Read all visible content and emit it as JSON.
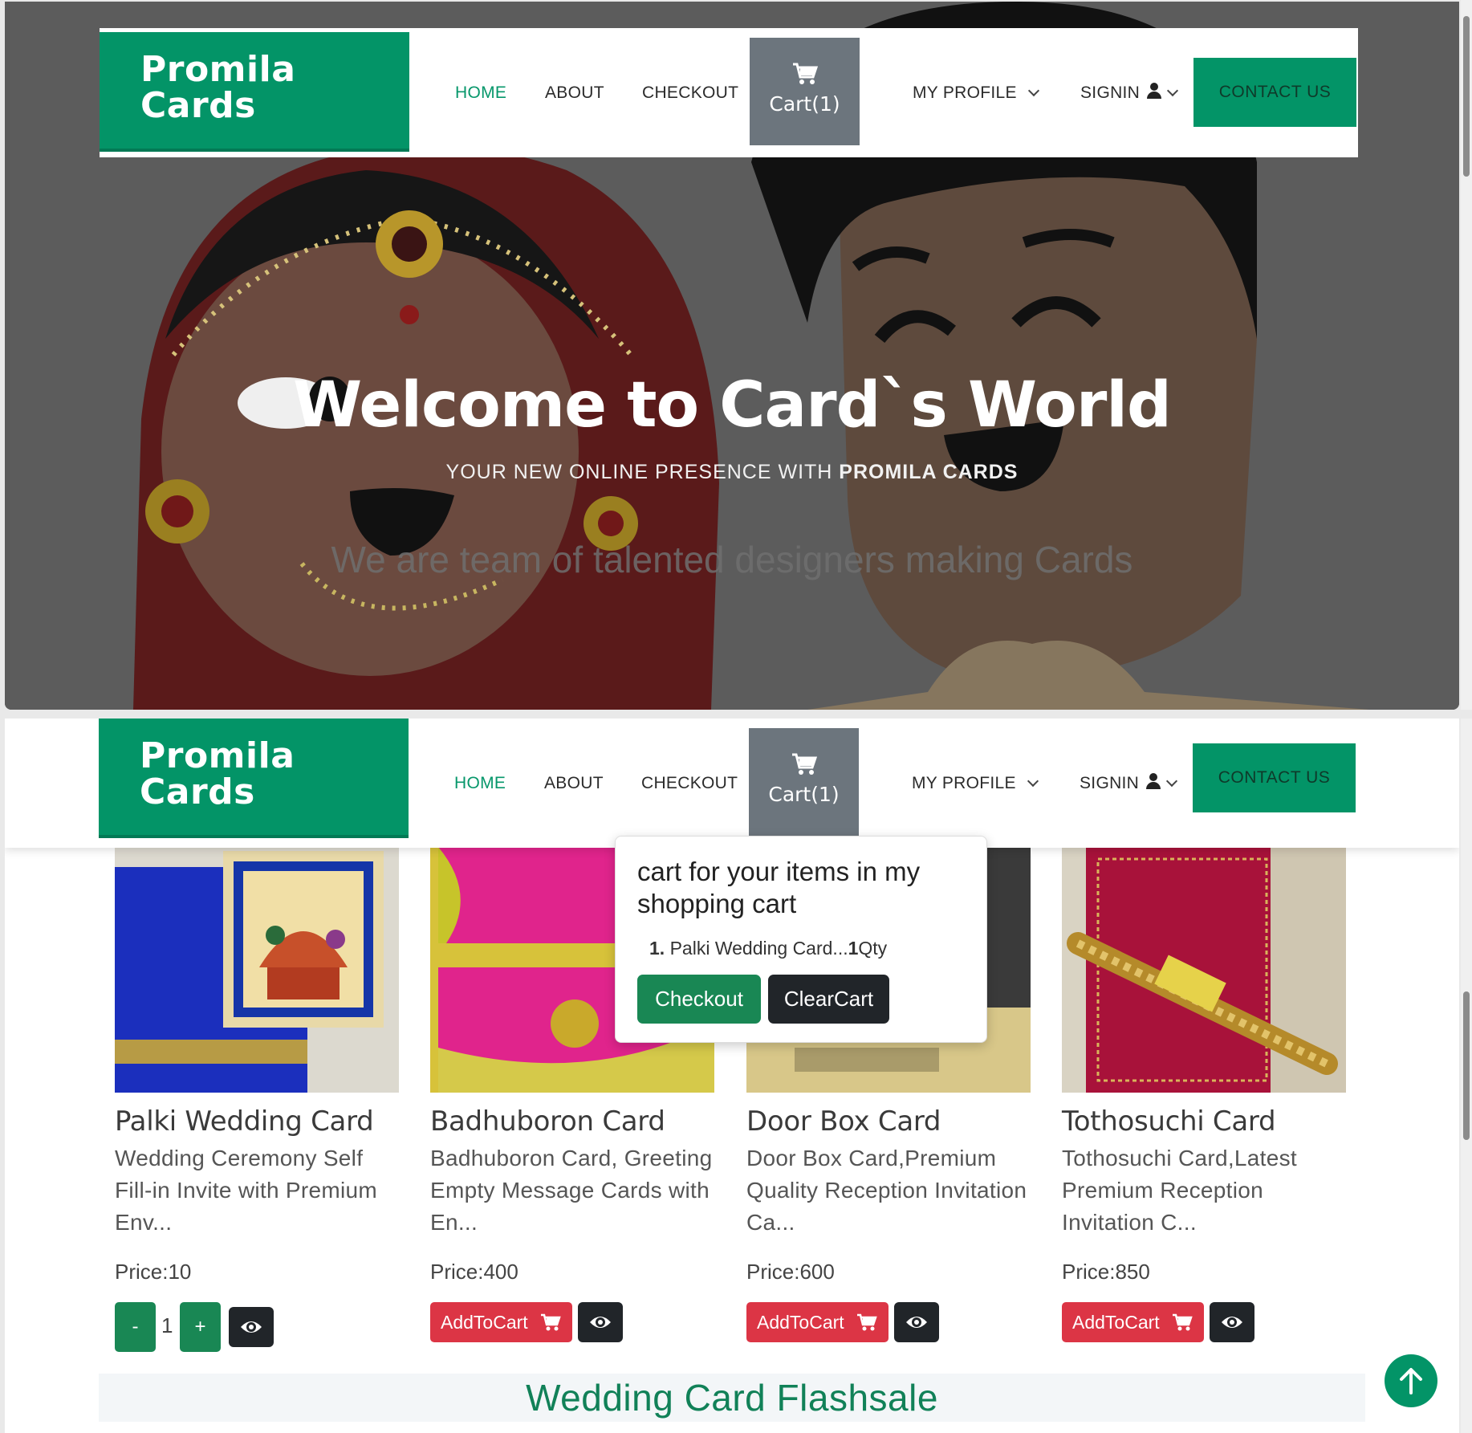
{
  "brand": {
    "name_line1": "Promila",
    "name_line2": "Cards"
  },
  "nav": {
    "home": "HOME",
    "about": "ABOUT",
    "checkout": "CHECKOUT",
    "cart": "Cart(1)",
    "my_profile": "MY PROFILE",
    "signin": "SIGNIN",
    "contact": "CONTACT US"
  },
  "hero": {
    "title": "Welcome to Card`s World",
    "subtitle_prefix": "YOUR NEW ONLINE PRESENCE WITH ",
    "subtitle_brand": "PROMILA CARDS",
    "tagline": "We are team of talented designers making Cards"
  },
  "cart_popover": {
    "title": "cart for your items in my shopping cart",
    "item_index": "1.",
    "item_name": " Palki Wedding Card...",
    "item_qty": "1",
    "item_qty_unit": "Qty",
    "checkout_label": "Checkout",
    "clear_label": "ClearCart"
  },
  "products": [
    {
      "title": "Palki Wedding Card",
      "desc": "Wedding Ceremony Self Fill-in Invite with Premium Env...",
      "price": "Price:10",
      "qty": "1",
      "minus": "-",
      "plus": "+"
    },
    {
      "title": "Badhuboron Card",
      "desc": "Badhuboron Card, Greeting Empty Message Cards with En...",
      "price": "Price:400",
      "add_label": "AddToCart"
    },
    {
      "title": "Door Box Card",
      "desc": "Door Box Card,Premium Quality Reception Invitation Ca...",
      "price": "Price:600",
      "add_label": "AddToCart"
    },
    {
      "title": "Tothosuchi Card",
      "desc": "Tothosuchi Card,Latest Premium Reception Invitation C...",
      "price": "Price:850",
      "add_label": "AddToCart"
    }
  ],
  "section_heading": "Wedding Card Flashsale",
  "icons": {
    "cart": "cart-icon",
    "user": "user-icon",
    "chevron": "chevron-down-icon",
    "eye": "eye-icon",
    "back_to_top": "arrow-up-icon"
  },
  "colors": {
    "brand_green": "#039467",
    "add_to_cart_red": "#dc3545",
    "cart_gray": "#6c757d",
    "dark_button": "#212529"
  }
}
